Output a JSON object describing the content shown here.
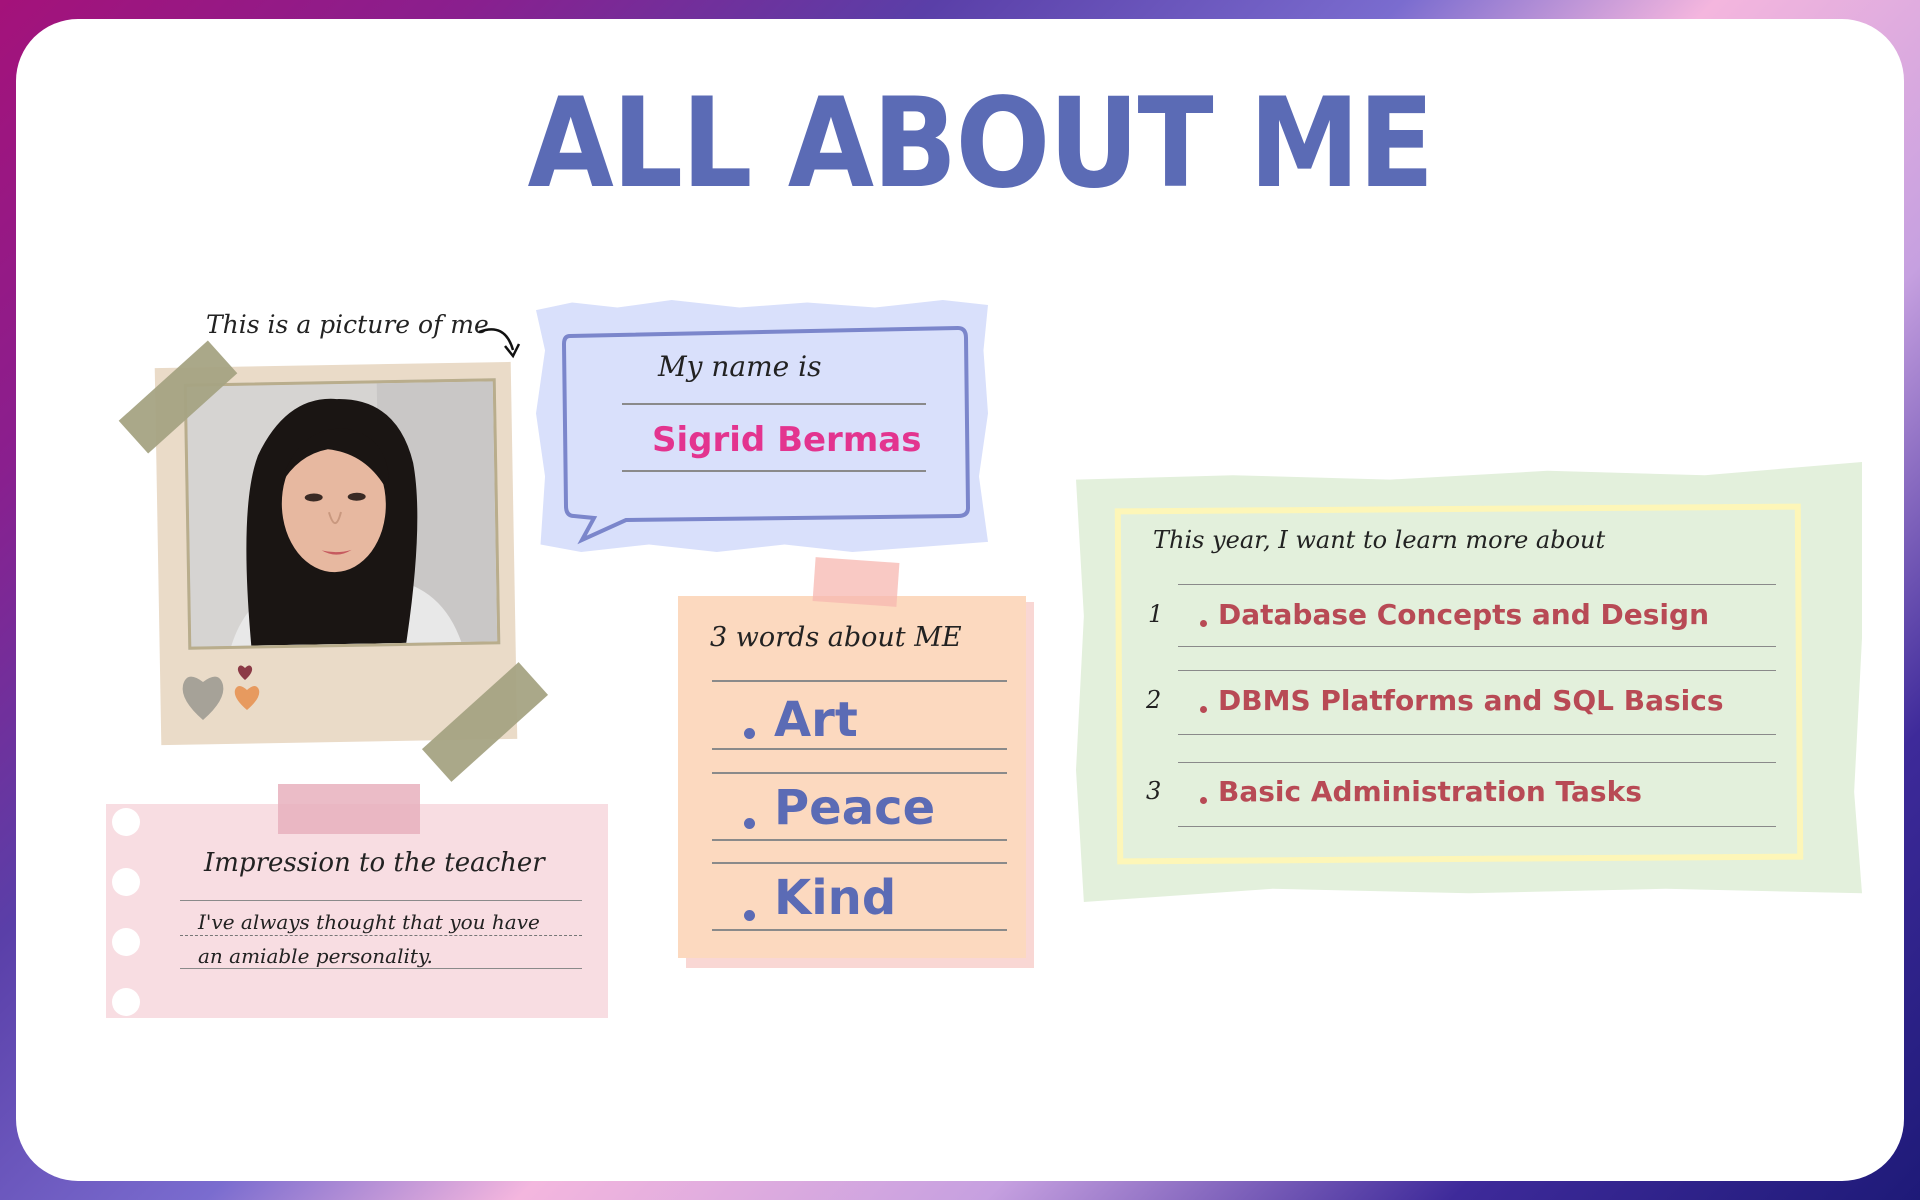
{
  "title": "ALL ABOUT ME",
  "photo": {
    "caption": "This is a picture of me",
    "portrait_icon": "portrait-photo",
    "frame_color": "#eadbc8",
    "tape_color": "#a5a383"
  },
  "name_card": {
    "label": "My name is",
    "value": "Sigrid Bermas",
    "bg_color": "#d9e0fb",
    "value_color": "#e3348f"
  },
  "words_card": {
    "label": "3 words about ME",
    "words": [
      "Art",
      "Peace",
      "Kind"
    ],
    "bg_color": "#fcd9bf",
    "word_color": "#5b6bb5"
  },
  "impression_card": {
    "label": "Impression to the teacher",
    "text_line1": "I've always thought that you have",
    "text_line2": "an amiable personality.",
    "bg_color": "#f8dde2"
  },
  "learn_card": {
    "label": "This year, I want to learn more about",
    "items": [
      {
        "number": "1",
        "text": "Database Concepts and Design"
      },
      {
        "number": "2",
        "text": "DBMS Platforms and SQL Basics"
      },
      {
        "number": "3",
        "text": "Basic Administration Tasks"
      }
    ],
    "bg_color": "#e3f0dc",
    "item_color": "#b84a55"
  }
}
